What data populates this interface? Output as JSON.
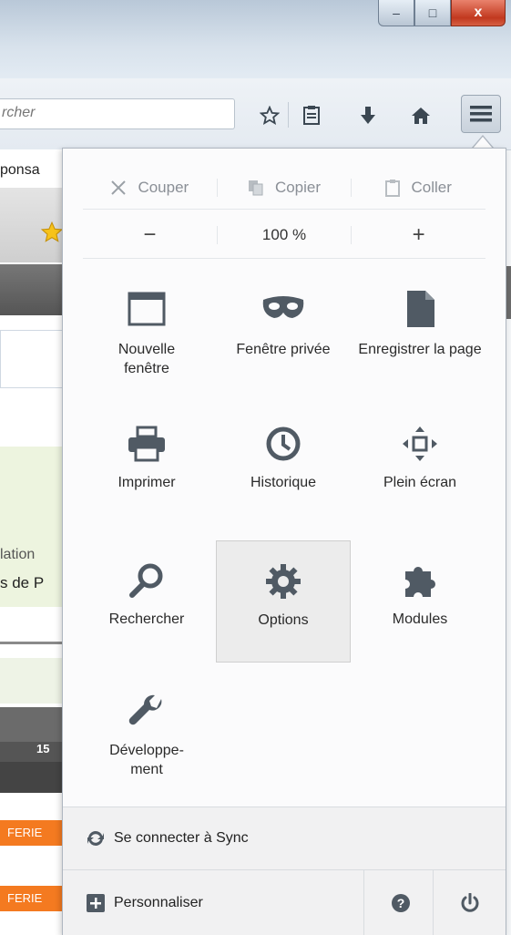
{
  "window": {
    "minimize_label": "–",
    "restore_label": "□",
    "close_label": "x"
  },
  "navbar": {
    "search_placeholder": "rcher",
    "icons": [
      "bookmark-star-icon",
      "reading-list-icon",
      "download-icon",
      "home-icon",
      "hamburger-menu-icon"
    ]
  },
  "page": {
    "text_1": "ponsa",
    "text_2": "lation",
    "text_3": "s de P",
    "cal_number": "15",
    "badge_1": "FERIE",
    "badge_2": "FERIE"
  },
  "menu": {
    "edit": {
      "cut": "Couper",
      "copy": "Copier",
      "paste": "Coller"
    },
    "zoom": {
      "minus": "−",
      "level": "100 %",
      "plus": "+"
    },
    "items": [
      {
        "label": "Nouvelle fenêtre",
        "icon": "new-window-icon"
      },
      {
        "label": "Fenêtre privée",
        "icon": "private-mask-icon"
      },
      {
        "label": "Enregistrer la page",
        "icon": "save-page-icon"
      },
      {
        "label": "Imprimer",
        "icon": "printer-icon"
      },
      {
        "label": "Historique",
        "icon": "history-clock-icon"
      },
      {
        "label": "Plein écran",
        "icon": "fullscreen-icon"
      },
      {
        "label": "Rechercher",
        "icon": "search-icon"
      },
      {
        "label": "Options",
        "icon": "gear-icon"
      },
      {
        "label": "Modules",
        "icon": "puzzle-icon"
      },
      {
        "label": "Développe-ment",
        "icon": "wrench-icon"
      }
    ],
    "sync_label": "Se connecter à Sync",
    "customize_label": "Personnaliser",
    "help_icon": "help-icon",
    "quit_icon": "power-icon"
  },
  "colors": {
    "accent_orange": "#f47a20",
    "icon_gray": "#505a64",
    "titlebar": "#c9d6e3"
  }
}
